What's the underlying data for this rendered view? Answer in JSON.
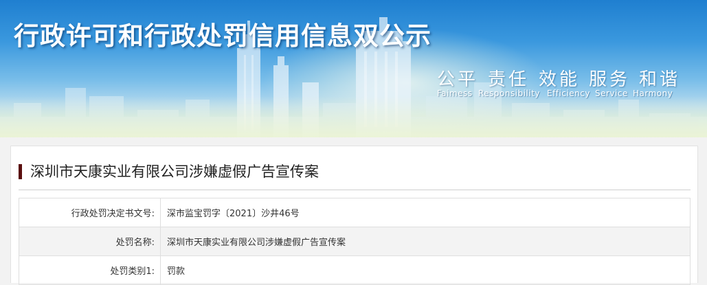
{
  "banner": {
    "title": "行政许可和行政处罚信用信息双公示",
    "slogans_cn": [
      "公平",
      "责任",
      "效能",
      "服务",
      "和谐"
    ],
    "slogans_en": [
      "Faimess",
      "Responsibility",
      "Efficiency",
      "Service",
      "Harmony"
    ]
  },
  "case": {
    "title": "深圳市天康实业有限公司涉嫌虚假广告宣传案",
    "accent_color": "#5a0c0c"
  },
  "details": {
    "rows": [
      {
        "label": "行政处罚决定书文号:",
        "value": "深市监宝罚字〔2021〕沙井46号"
      },
      {
        "label": "处罚名称:",
        "value": "深圳市天康实业有限公司涉嫌虚假广告宣传案"
      },
      {
        "label": "处罚类别1:",
        "value": "罚款"
      }
    ]
  }
}
